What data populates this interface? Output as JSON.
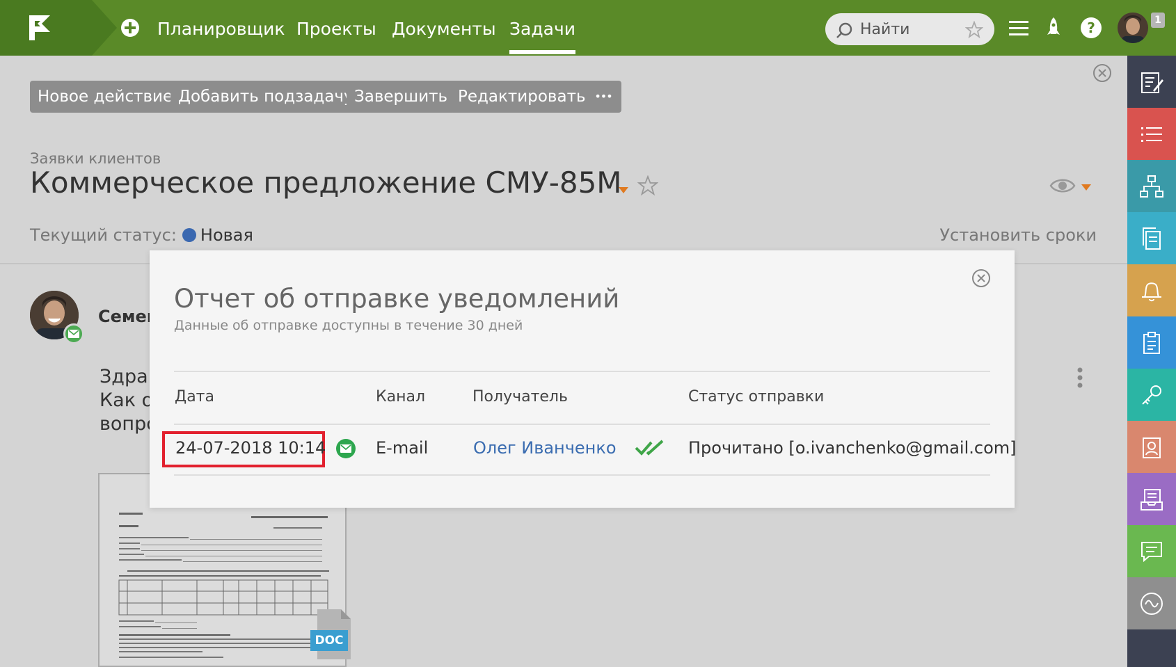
{
  "nav": {
    "items": [
      "Планировщик",
      "Проекты",
      "Документы",
      "Задачи"
    ],
    "active_index": 3,
    "search_placeholder": "Найти",
    "notification_count": "1",
    "accent_color": "#5a8a28"
  },
  "toolbar": {
    "new_action": "Новое действие",
    "add_subtask": "Добавить подзадачу",
    "complete": "Завершить",
    "edit": "Редактировать",
    "more": "•••"
  },
  "task": {
    "breadcrumb": "Заявки клиентов",
    "title": "Коммерческое предложение СМУ-85М",
    "status_label": "Текущий статус:",
    "status_value": "Новая",
    "status_color": "#3a68b0",
    "set_dates": "Установить сроки"
  },
  "comment": {
    "author": "Семен",
    "text_lines": [
      "Здрав",
      "Как об",
      "вопро"
    ],
    "attachment_type": "DOC"
  },
  "modal": {
    "title": "Отчет об отправке уведомлений",
    "subtitle": "Данные об отправке доступны в течение 30 дней",
    "columns": {
      "date": "Дата",
      "channel": "Канал",
      "recipient": "Получатель",
      "status": "Статус отправки"
    },
    "row": {
      "date": "24-07-2018 10:14",
      "channel_icon": "email-icon",
      "channel": "E-mail",
      "recipient": "Олег Иванченко",
      "status_icon": "double-check-icon",
      "status": "Прочитано [o.ivanchenko@gmail.com]"
    }
  },
  "sidebar": {
    "items": [
      {
        "icon": "edit-note-icon",
        "color": "#3c4152"
      },
      {
        "icon": "list-icon",
        "color": "#d9534f"
      },
      {
        "icon": "hierarchy-icon",
        "color": "#3a9aa8"
      },
      {
        "icon": "documents-icon",
        "color": "#3aaec8"
      },
      {
        "icon": "bell-icon",
        "color": "#d6a24e"
      },
      {
        "icon": "clipboard-icon",
        "color": "#3592d8"
      },
      {
        "icon": "key-icon",
        "color": "#2bb5a4"
      },
      {
        "icon": "contact-icon",
        "color": "#d9876e"
      },
      {
        "icon": "inbox-icon",
        "color": "#9a6cc4"
      },
      {
        "icon": "chat-icon",
        "color": "#6ab850"
      },
      {
        "icon": "wave-icon",
        "color": "#8f8f8f"
      }
    ]
  }
}
